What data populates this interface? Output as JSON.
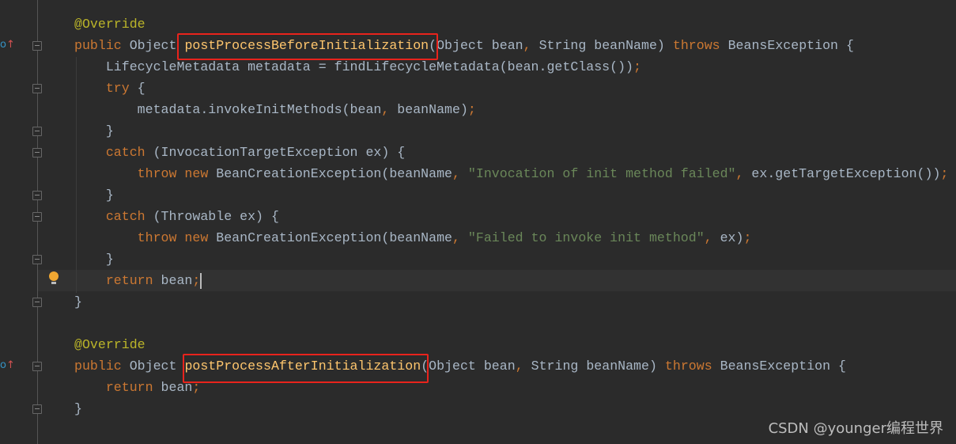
{
  "editor": {
    "colors": {
      "background": "#2b2b2b",
      "keyword": "#cc7832",
      "text": "#a9b7c6",
      "string": "#6a8759",
      "annotation": "#bbb529",
      "method": "#ffc66d",
      "highlight_box": "#e8231c"
    },
    "lines": [
      [
        [
          "ann",
          "@Override"
        ]
      ],
      [
        [
          "kw",
          "public "
        ],
        [
          "tx",
          "Object "
        ],
        [
          "fn",
          "postProcessBeforeInitialization"
        ],
        [
          "tx",
          "(Object bean"
        ],
        [
          "kw",
          ", "
        ],
        [
          "tx",
          "String beanName) "
        ],
        [
          "kw",
          "throws "
        ],
        [
          "tx",
          "BeansException {"
        ]
      ],
      [
        [
          "tx",
          "    LifecycleMetadata metadata = findLifecycleMetadata(bean.getClass())"
        ],
        [
          "kw",
          ";"
        ]
      ],
      [
        [
          "kw",
          "    try "
        ],
        [
          "tx",
          "{"
        ]
      ],
      [
        [
          "tx",
          "        metadata.invokeInitMethods(bean"
        ],
        [
          "kw",
          ", "
        ],
        [
          "tx",
          "beanName)"
        ],
        [
          "kw",
          ";"
        ]
      ],
      [
        [
          "tx",
          "    }"
        ]
      ],
      [
        [
          "kw",
          "    catch "
        ],
        [
          "tx",
          "(InvocationTargetException ex) {"
        ]
      ],
      [
        [
          "kw",
          "        throw new "
        ],
        [
          "tx",
          "BeanCreationException(beanName"
        ],
        [
          "kw",
          ", "
        ],
        [
          "str",
          "\"Invocation of init method failed\""
        ],
        [
          "kw",
          ", "
        ],
        [
          "tx",
          "ex.getTargetException())"
        ],
        [
          "kw",
          ";"
        ]
      ],
      [
        [
          "tx",
          "    }"
        ]
      ],
      [
        [
          "kw",
          "    catch "
        ],
        [
          "tx",
          "(Throwable ex) {"
        ]
      ],
      [
        [
          "kw",
          "        throw new "
        ],
        [
          "tx",
          "BeanCreationException(beanName"
        ],
        [
          "kw",
          ", "
        ],
        [
          "str",
          "\"Failed to invoke init method\""
        ],
        [
          "kw",
          ", "
        ],
        [
          "tx",
          "ex)"
        ],
        [
          "kw",
          ";"
        ]
      ],
      [
        [
          "tx",
          "    }"
        ]
      ],
      [
        [
          "kw",
          "    return "
        ],
        [
          "tx",
          "bean"
        ],
        [
          "kw",
          ";"
        ]
      ],
      [
        [
          "tx",
          "}"
        ]
      ],
      [],
      [
        [
          "ann",
          "@Override"
        ]
      ],
      [
        [
          "kw",
          "public "
        ],
        [
          "tx",
          "Object "
        ],
        [
          "fn",
          "postProcessAfterInitialization"
        ],
        [
          "tx",
          "(Object bean"
        ],
        [
          "kw",
          ", "
        ],
        [
          "tx",
          "String beanName) "
        ],
        [
          "kw",
          "throws "
        ],
        [
          "tx",
          "BeansException {"
        ]
      ],
      [
        [
          "kw",
          "    return "
        ],
        [
          "tx",
          "bean"
        ],
        [
          "kw",
          ";"
        ]
      ],
      [
        [
          "tx",
          "}"
        ]
      ]
    ],
    "gutter_icons": [
      "override-icon",
      "override-icon",
      "intention-bulb-icon"
    ]
  },
  "watermark": "CSDN @younger编程世界"
}
